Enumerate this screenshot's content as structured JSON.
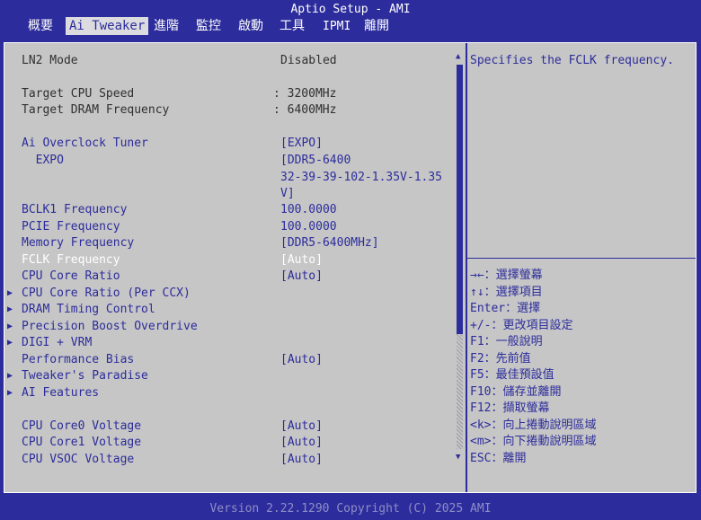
{
  "title": "Aptio Setup - AMI",
  "tabs": [
    {
      "label": "概要"
    },
    {
      "label": "Ai Tweaker"
    },
    {
      "label": "進階"
    },
    {
      "label": "監控"
    },
    {
      "label": "啟動"
    },
    {
      "label": "工具"
    },
    {
      "label": "IPMI"
    },
    {
      "label": "離開"
    }
  ],
  "settings": [
    {
      "label": "LN2 Mode",
      "value": "Disabled"
    },
    {
      "label": "Target CPU Speed",
      "value": ": 3200MHz"
    },
    {
      "label": "Target DRAM Frequency",
      "value": ": 6400MHz"
    },
    {
      "label": "Ai Overclock Tuner",
      "value": "[EXPO]"
    },
    {
      "label": "  EXPO",
      "value": "[DDR5-6400",
      "value2": "32-39-39-102-1.35V-1.35",
      "value3": "V]"
    },
    {
      "label": "BCLK1 Frequency",
      "value": "100.0000"
    },
    {
      "label": "PCIE Frequency",
      "value": "100.0000"
    },
    {
      "label": "Memory Frequency",
      "value": "[DDR5-6400MHz]"
    },
    {
      "label": "FCLK Frequency",
      "value": "[Auto]"
    },
    {
      "label": "CPU Core Ratio",
      "value": "[Auto]"
    },
    {
      "label": "CPU Core Ratio (Per CCX)"
    },
    {
      "label": "DRAM Timing Control"
    },
    {
      "label": "Precision Boost Overdrive"
    },
    {
      "label": "DIGI + VRM"
    },
    {
      "label": "Performance Bias",
      "value": "[Auto]"
    },
    {
      "label": "Tweaker's Paradise"
    },
    {
      "label": "AI Features"
    },
    {
      "label": "CPU Core0 Voltage",
      "value": "[Auto]"
    },
    {
      "label": "CPU Core1 Voltage",
      "value": "[Auto]"
    },
    {
      "label": "CPU VSOC Voltage",
      "value": "[Auto]"
    }
  ],
  "help": {
    "text": "Specifies the FCLK frequency.",
    "keys": [
      "→←：選擇螢幕",
      "↑↓：選擇項目",
      "Enter：選擇",
      "+/-：更改項目設定",
      "F1：一般說明",
      "F2：先前值",
      "F5：最佳預設值",
      "F10：儲存並離開",
      "F12：擷取螢幕",
      "<k>：向上捲動說明區域",
      "<m>：向下捲動說明區域",
      "ESC：離開"
    ]
  },
  "footer": "Version 2.22.1290 Copyright (C) 2025 AMI",
  "colors": {
    "background": "#2c2c9c",
    "panel": "#c6c6c6",
    "accent": "#2c2c9c",
    "highlight": "#ffffff"
  }
}
